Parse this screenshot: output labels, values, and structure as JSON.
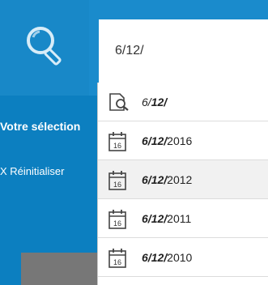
{
  "search": {
    "value": "6/12/",
    "icon": "magnifier-icon"
  },
  "sidebar": {
    "selection_label": "Votre sélection",
    "reset_label": "X Réinitialiser"
  },
  "suggestions": [
    {
      "icon": "document-search-icon",
      "prefix": "6/",
      "bold": "12",
      "suffix": "/",
      "rest": ""
    },
    {
      "icon": "calendar-icon",
      "prefix": "6/",
      "bold": "12",
      "suffix": "/",
      "rest": "2016",
      "day": "16"
    },
    {
      "icon": "calendar-icon",
      "prefix": "6/",
      "bold": "12",
      "suffix": "/",
      "rest": "2012",
      "day": "16"
    },
    {
      "icon": "calendar-icon",
      "prefix": "6/",
      "bold": "12",
      "suffix": "/",
      "rest": "2011",
      "day": "16"
    },
    {
      "icon": "calendar-icon",
      "prefix": "6/",
      "bold": "12",
      "suffix": "/",
      "rest": "2010",
      "day": "16"
    }
  ]
}
